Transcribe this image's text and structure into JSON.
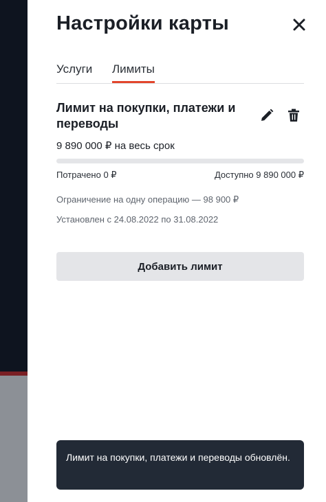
{
  "page_title": "Настройки карты",
  "tabs": [
    {
      "label": "Услуги",
      "active": false
    },
    {
      "label": "Лимиты",
      "active": true
    }
  ],
  "accent_color": "#e2452b",
  "limit": {
    "title": "Лимит на покупки, платежи и переводы",
    "amount": "9 890 000 ₽ на весь срок",
    "spent": "Потрачено 0 ₽",
    "available": "Доступно 9 890 000 ₽",
    "spent_fraction": 0,
    "per_operation": "Ограничение на одну операцию — 98 900 ₽",
    "period": "Установлен с 24.08.2022 по 31.08.2022",
    "edit_icon": "pencil-icon",
    "delete_icon": "trash-icon"
  },
  "add_limit_label": "Добавить лимит",
  "toast": {
    "message": "Лимит на покупки, платежи и переводы обновлён."
  },
  "close_icon": "close-icon"
}
